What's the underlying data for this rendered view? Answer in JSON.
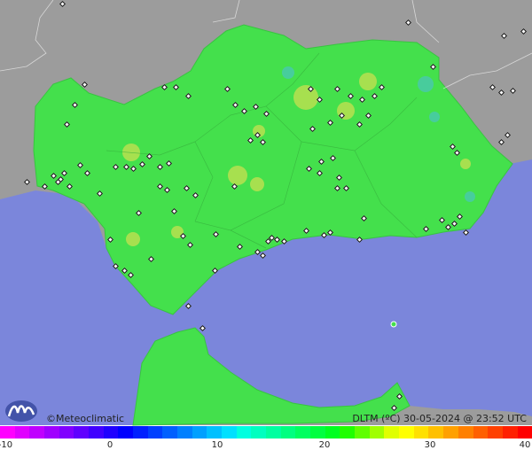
{
  "credit": "©Meteoclimatic",
  "map_title": "DLTM (ºC)  30-05-2024 @ 23:52 UTC",
  "scale": {
    "ticks": [
      "-10",
      "0",
      "10",
      "20",
      "30",
      "40"
    ],
    "colors": [
      "#ff00ff",
      "#e000ff",
      "#c000ff",
      "#a000ff",
      "#8000ff",
      "#6000ff",
      "#4000ff",
      "#2000ff",
      "#0000ff",
      "#0020ff",
      "#0040ff",
      "#0060ff",
      "#0080ff",
      "#00a0ff",
      "#00c0ff",
      "#00e0ff",
      "#00ffe0",
      "#00ffc0",
      "#00ffa0",
      "#00ff80",
      "#00ff60",
      "#00ff40",
      "#00ff20",
      "#20ff00",
      "#60ff00",
      "#a0ff00",
      "#e0ff00",
      "#ffff00",
      "#ffe000",
      "#ffc000",
      "#ffa000",
      "#ff8000",
      "#ff6000",
      "#ff4000",
      "#ff2000",
      "#ff0000"
    ]
  },
  "colors": {
    "sea": "#7b86db",
    "land_outside": "#9a9a9a",
    "region_fill": "#44e04c",
    "warm_spot": "#c8e050",
    "cool_spot": "#49c8b0"
  }
}
